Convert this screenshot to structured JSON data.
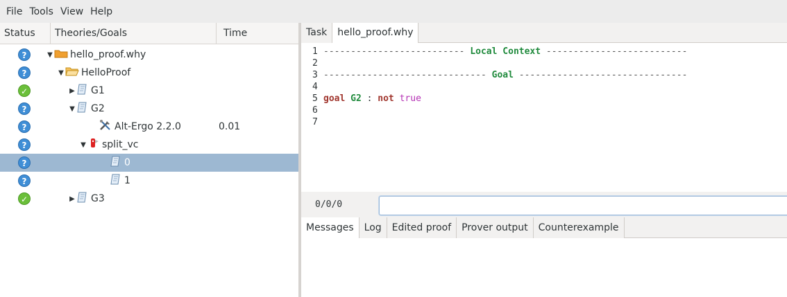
{
  "menu": [
    "File",
    "Tools",
    "View",
    "Help"
  ],
  "tree": {
    "columns": {
      "status": "Status",
      "goals": "Theories/Goals",
      "time": "Time"
    },
    "rows": [
      {
        "label": "hello_proof.why",
        "status": "unknown",
        "icon": "folder-icon",
        "expander": "expanded",
        "time": ""
      },
      {
        "label": "HelloProof",
        "status": "unknown",
        "icon": "open-folder-icon",
        "expander": "expanded",
        "time": ""
      },
      {
        "label": "G1",
        "status": "valid",
        "icon": "scroll-icon",
        "expander": "collapsed",
        "time": ""
      },
      {
        "label": "G2",
        "status": "unknown",
        "icon": "scroll-icon",
        "expander": "expanded",
        "time": ""
      },
      {
        "label": "Alt-Ergo 2.2.0",
        "status": "unknown",
        "icon": "tools-icon",
        "expander": "",
        "time": "0.01"
      },
      {
        "label": "split_vc",
        "status": "unknown",
        "icon": "knife-icon",
        "expander": "expanded",
        "time": ""
      },
      {
        "label": "0",
        "status": "unknown",
        "icon": "scroll-icon",
        "expander": "",
        "time": "",
        "selected": true
      },
      {
        "label": "1",
        "status": "unknown",
        "icon": "scroll-icon",
        "expander": "",
        "time": ""
      },
      {
        "label": "G3",
        "status": "valid",
        "icon": "scroll-icon",
        "expander": "collapsed",
        "time": ""
      }
    ]
  },
  "top_tabs": [
    "Task",
    "hello_proof.why"
  ],
  "editor": {
    "lines": [
      {
        "n": "1",
        "kind": "header",
        "text": "Local Context"
      },
      {
        "n": "2",
        "kind": "blank"
      },
      {
        "n": "3",
        "kind": "header",
        "text": "Goal"
      },
      {
        "n": "4",
        "kind": "blank"
      },
      {
        "n": "5",
        "kind": "goal",
        "keyword": "goal",
        "name": "G2",
        "sep": ":",
        "neg": "not",
        "value": "true"
      },
      {
        "n": "6",
        "kind": "blank"
      },
      {
        "n": "7",
        "kind": "blank"
      }
    ]
  },
  "command": {
    "counter": "0/0/0",
    "value": ""
  },
  "bottom_tabs": [
    "Messages",
    "Log",
    "Edited proof",
    "Prover output",
    "Counterexample"
  ],
  "colors": {
    "selected_row": "#9db8d2",
    "unknown_status": "#3f8ed6",
    "valid_status": "#6bbf3a"
  }
}
